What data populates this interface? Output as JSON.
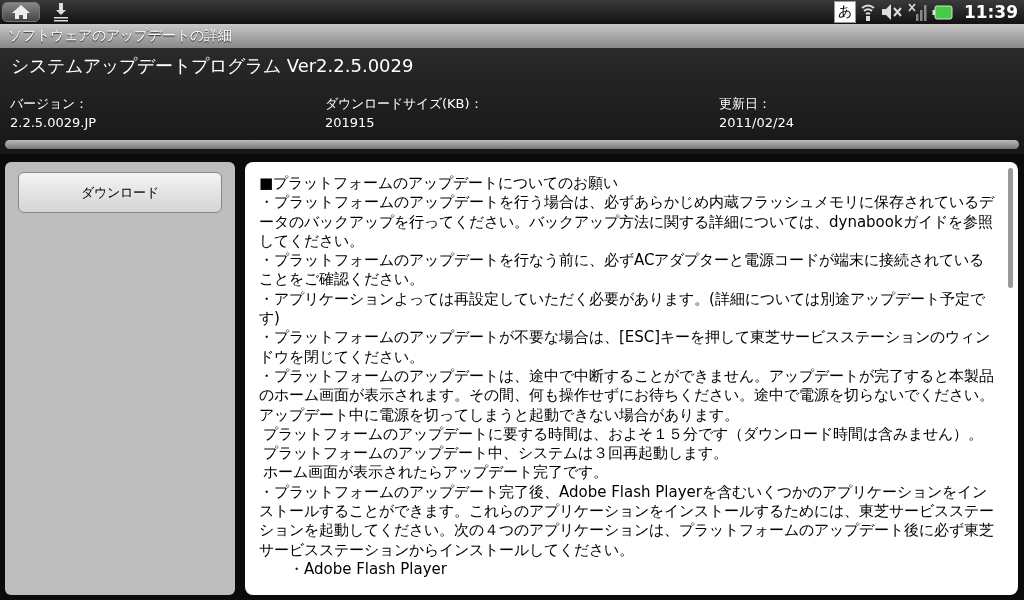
{
  "status_bar": {
    "ime": "あ",
    "time": "11:39"
  },
  "title_bar": {
    "title": "ソフトウェアのアップデートの詳細"
  },
  "header": {
    "title": "システムアップデートプログラム Ver2.2.5.0029",
    "fields": [
      {
        "label": "バージョン：",
        "value": "2.2.5.0029.JP"
      },
      {
        "label": "ダウンロードサイズ(KB)：",
        "value": "201915"
      },
      {
        "label": "更新日：",
        "value": "2011/02/24"
      }
    ],
    "progress": {
      "level": 0
    }
  },
  "download_button": "ダウンロード",
  "notes": [
    {
      "kind": "plain",
      "text": "■プラットフォームのアップデートについてのお願い"
    },
    {
      "kind": "plain",
      "text": "・プラットフォームのアップデートを行う場合は、必ずあらかじめ内蔵フラッシュメモリに保存されているデータのバックアップを行ってください。バックアップ方法に関する詳細については、dynabookガイドを参照してください。"
    },
    {
      "kind": "plain",
      "text": "・プラットフォームのアップデートを行なう前に、必ずACアダプターと電源コードが端末に接続されていることをご確認ください。"
    },
    {
      "kind": "plain",
      "text": "・アプリケーションよっては再設定していただく必要があります。(詳細については別途アップデート予定です)"
    },
    {
      "kind": "plain",
      "text": "・プラットフォームのアップデートが不要な場合は、[ESC]キーを押して東芝サービスステーションのウィンドウを閉じてください。"
    },
    {
      "kind": "plain",
      "text": "・プラットフォームのアップデートは、途中で中断することができません。アップデートが完了すると本製品のホーム画面が表示されます。その間、何も操作せずにお待ちください。途中で電源を切らないでください。アップデート中に電源を切ってしまうと起動できない場合があります。"
    },
    {
      "kind": "shifted",
      "text": "プラットフォームのアップデートに要する時間は、およそ１５分です（ダウンロード時間は含みません）。"
    },
    {
      "kind": "shifted",
      "text": "プラットフォームのアップデート中、システムは３回再起動します。"
    },
    {
      "kind": "shifted",
      "text": "ホーム画面が表示されたらアップデート完了です。"
    },
    {
      "kind": "plain",
      "text": "・プラットフォームのアップデート完了後、Adobe Flash Playerを含むいくつかのアプリケーションをインストールすることができます。これらのアプリケーションをインストールするためには、東芝サービスステーションを起動してください。次の４つのアプリケーションは、プラットフォームのアップデート後に必ず東芝サービスステーションからインストールしてください。"
    },
    {
      "kind": "sub",
      "text": "・Adobe Flash Player"
    }
  ]
}
